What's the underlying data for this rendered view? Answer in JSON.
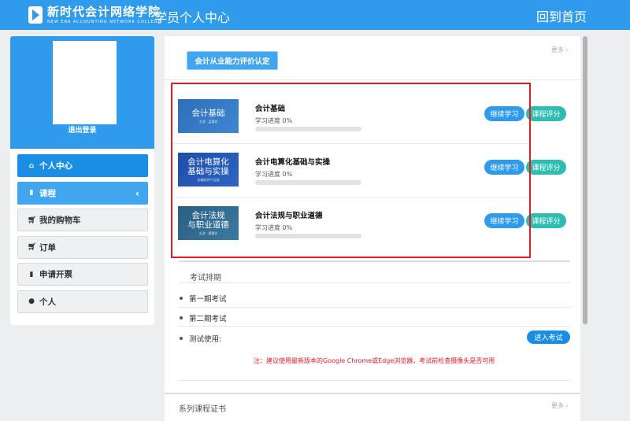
{
  "header": {
    "logo_cn": "新时代会计网络学院",
    "logo_en": "NEW ERA ACCOUNTING NETWORK COLLEGE",
    "title": "学员个人中心",
    "home_link": "回到首页",
    "colors": {
      "primary": "#2f9bea",
      "accent_teal": "#2fbcb3",
      "highlight_red": "#e21b23"
    }
  },
  "sidebar": {
    "logout": "退出登录",
    "items": [
      {
        "label": "个人中心",
        "icon": "home-icon"
      },
      {
        "label": "课程",
        "icon": "book-icon"
      },
      {
        "label": "我的购物车",
        "icon": "cart-icon"
      },
      {
        "label": "订单",
        "icon": "cart-icon"
      },
      {
        "label": "申请开票",
        "icon": "book-icon"
      },
      {
        "label": "个人",
        "icon": "user-icon"
      }
    ]
  },
  "main": {
    "cert_button": "会计从业能力评价认定",
    "more": "更多",
    "courses": [
      {
        "title": "会计基础",
        "progress_label": "学习进度 0%",
        "progress": 0,
        "thumb_title": "会计基础",
        "thumb_sub": "主讲：孟惠民",
        "study_btn": "继续学习",
        "rate_btn": "课程评分"
      },
      {
        "title": "会计电算化基础与实操",
        "progress_label": "学习进度 0%",
        "progress": 0,
        "thumb_title": "会计电算化\n基础与实操",
        "thumb_sub": "金蝶软件产品部",
        "study_btn": "继续学习",
        "rate_btn": "课程评分"
      },
      {
        "title": "会计法规与职业道德",
        "progress_label": "学习进度 0%",
        "progress": 0,
        "thumb_title": "会计法规\n与职业道德",
        "thumb_sub": "主讲：黄慧玲",
        "study_btn": "继续学习",
        "rate_btn": "课程评分"
      }
    ],
    "exam": {
      "heading": "考试排期",
      "items": [
        "第一期考试",
        "第二期考试",
        "测试使用:"
      ],
      "enter_btn": "进入考试",
      "notice": "注：建议使用最新版本的Google Chrome或Edge浏览器，考试前检查摄像头是否可用"
    },
    "series": {
      "title": "系列课程证书",
      "more": "更多"
    }
  }
}
